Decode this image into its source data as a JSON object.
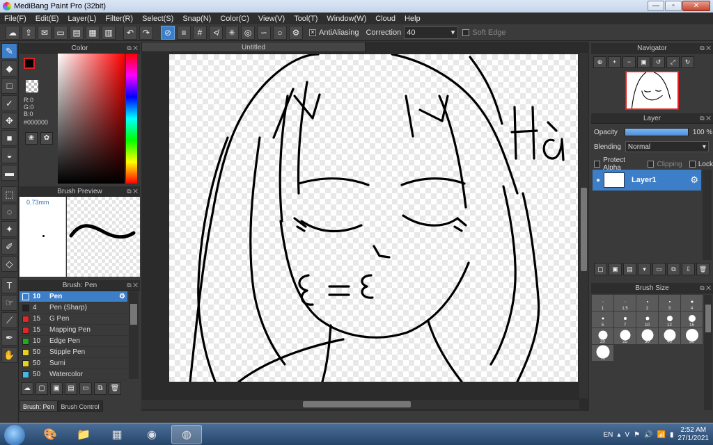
{
  "window": {
    "title": "MediBang Paint Pro (32bit)",
    "controls": [
      "—",
      "▫",
      "✕"
    ]
  },
  "menu": [
    "File(F)",
    "Edit(E)",
    "Layer(L)",
    "Filter(R)",
    "Select(S)",
    "Snap(N)",
    "Color(C)",
    "View(V)",
    "Tool(T)",
    "Window(W)",
    "Cloud",
    "Help"
  ],
  "toolbar": {
    "antialiasing_label": "AntiAliasing",
    "antialiasing_checked": true,
    "correction_label": "Correction",
    "correction_value": "40",
    "soft_edge_label": "Soft Edge",
    "soft_edge_checked": false
  },
  "color_panel": {
    "title": "Color",
    "r": "R:0",
    "g": "G:0",
    "b": "B:0",
    "hex": "#000000",
    "fg_color": "#000000",
    "accent": "#e02020"
  },
  "brush_preview": {
    "title": "Brush Preview",
    "size": "0.73mm"
  },
  "brush_list": {
    "title": "Brush: Pen",
    "items": [
      {
        "size": "10",
        "name": "Pen",
        "color": "#3d7ec9",
        "active": true
      },
      {
        "size": "4",
        "name": "Pen (Sharp)",
        "color": "#222222",
        "active": false
      },
      {
        "size": "15",
        "name": "G Pen",
        "color": "#e02828",
        "active": false
      },
      {
        "size": "15",
        "name": "Mapping Pen",
        "color": "#e02828",
        "active": false
      },
      {
        "size": "10",
        "name": "Edge Pen",
        "color": "#22aa22",
        "active": false
      },
      {
        "size": "50",
        "name": "Stipple Pen",
        "color": "#e8d020",
        "active": false
      },
      {
        "size": "50",
        "name": "Sumi",
        "color": "#e8d020",
        "active": false
      },
      {
        "size": "50",
        "name": "Watercolor",
        "color": "#44b8e8",
        "active": false
      }
    ],
    "tabs": [
      "Brush: Pen",
      "Brush Control"
    ]
  },
  "canvas": {
    "tab_title": "Untitled",
    "handwriting": "Hà"
  },
  "navigator": {
    "title": "Navigator"
  },
  "layer_panel": {
    "title": "Layer",
    "opacity_label": "Opacity",
    "opacity_value": "100 %",
    "opacity_fraction": 1.0,
    "blending_label": "Blending",
    "blending_value": "Normal",
    "protect_alpha": "Protect Alpha",
    "clipping": "Clipping",
    "lock": "Lock",
    "layers": [
      {
        "name": "Layer1"
      }
    ]
  },
  "brush_size": {
    "title": "Brush Size",
    "sizes": [
      "1",
      "1.5",
      "2",
      "3",
      "4",
      "5",
      "7",
      "10",
      "12",
      "15",
      "20",
      "25",
      "30",
      "40",
      "50",
      "70"
    ]
  },
  "taskbar": {
    "language": "EN",
    "time": "2:52 AM",
    "date": "27/1/2021"
  }
}
